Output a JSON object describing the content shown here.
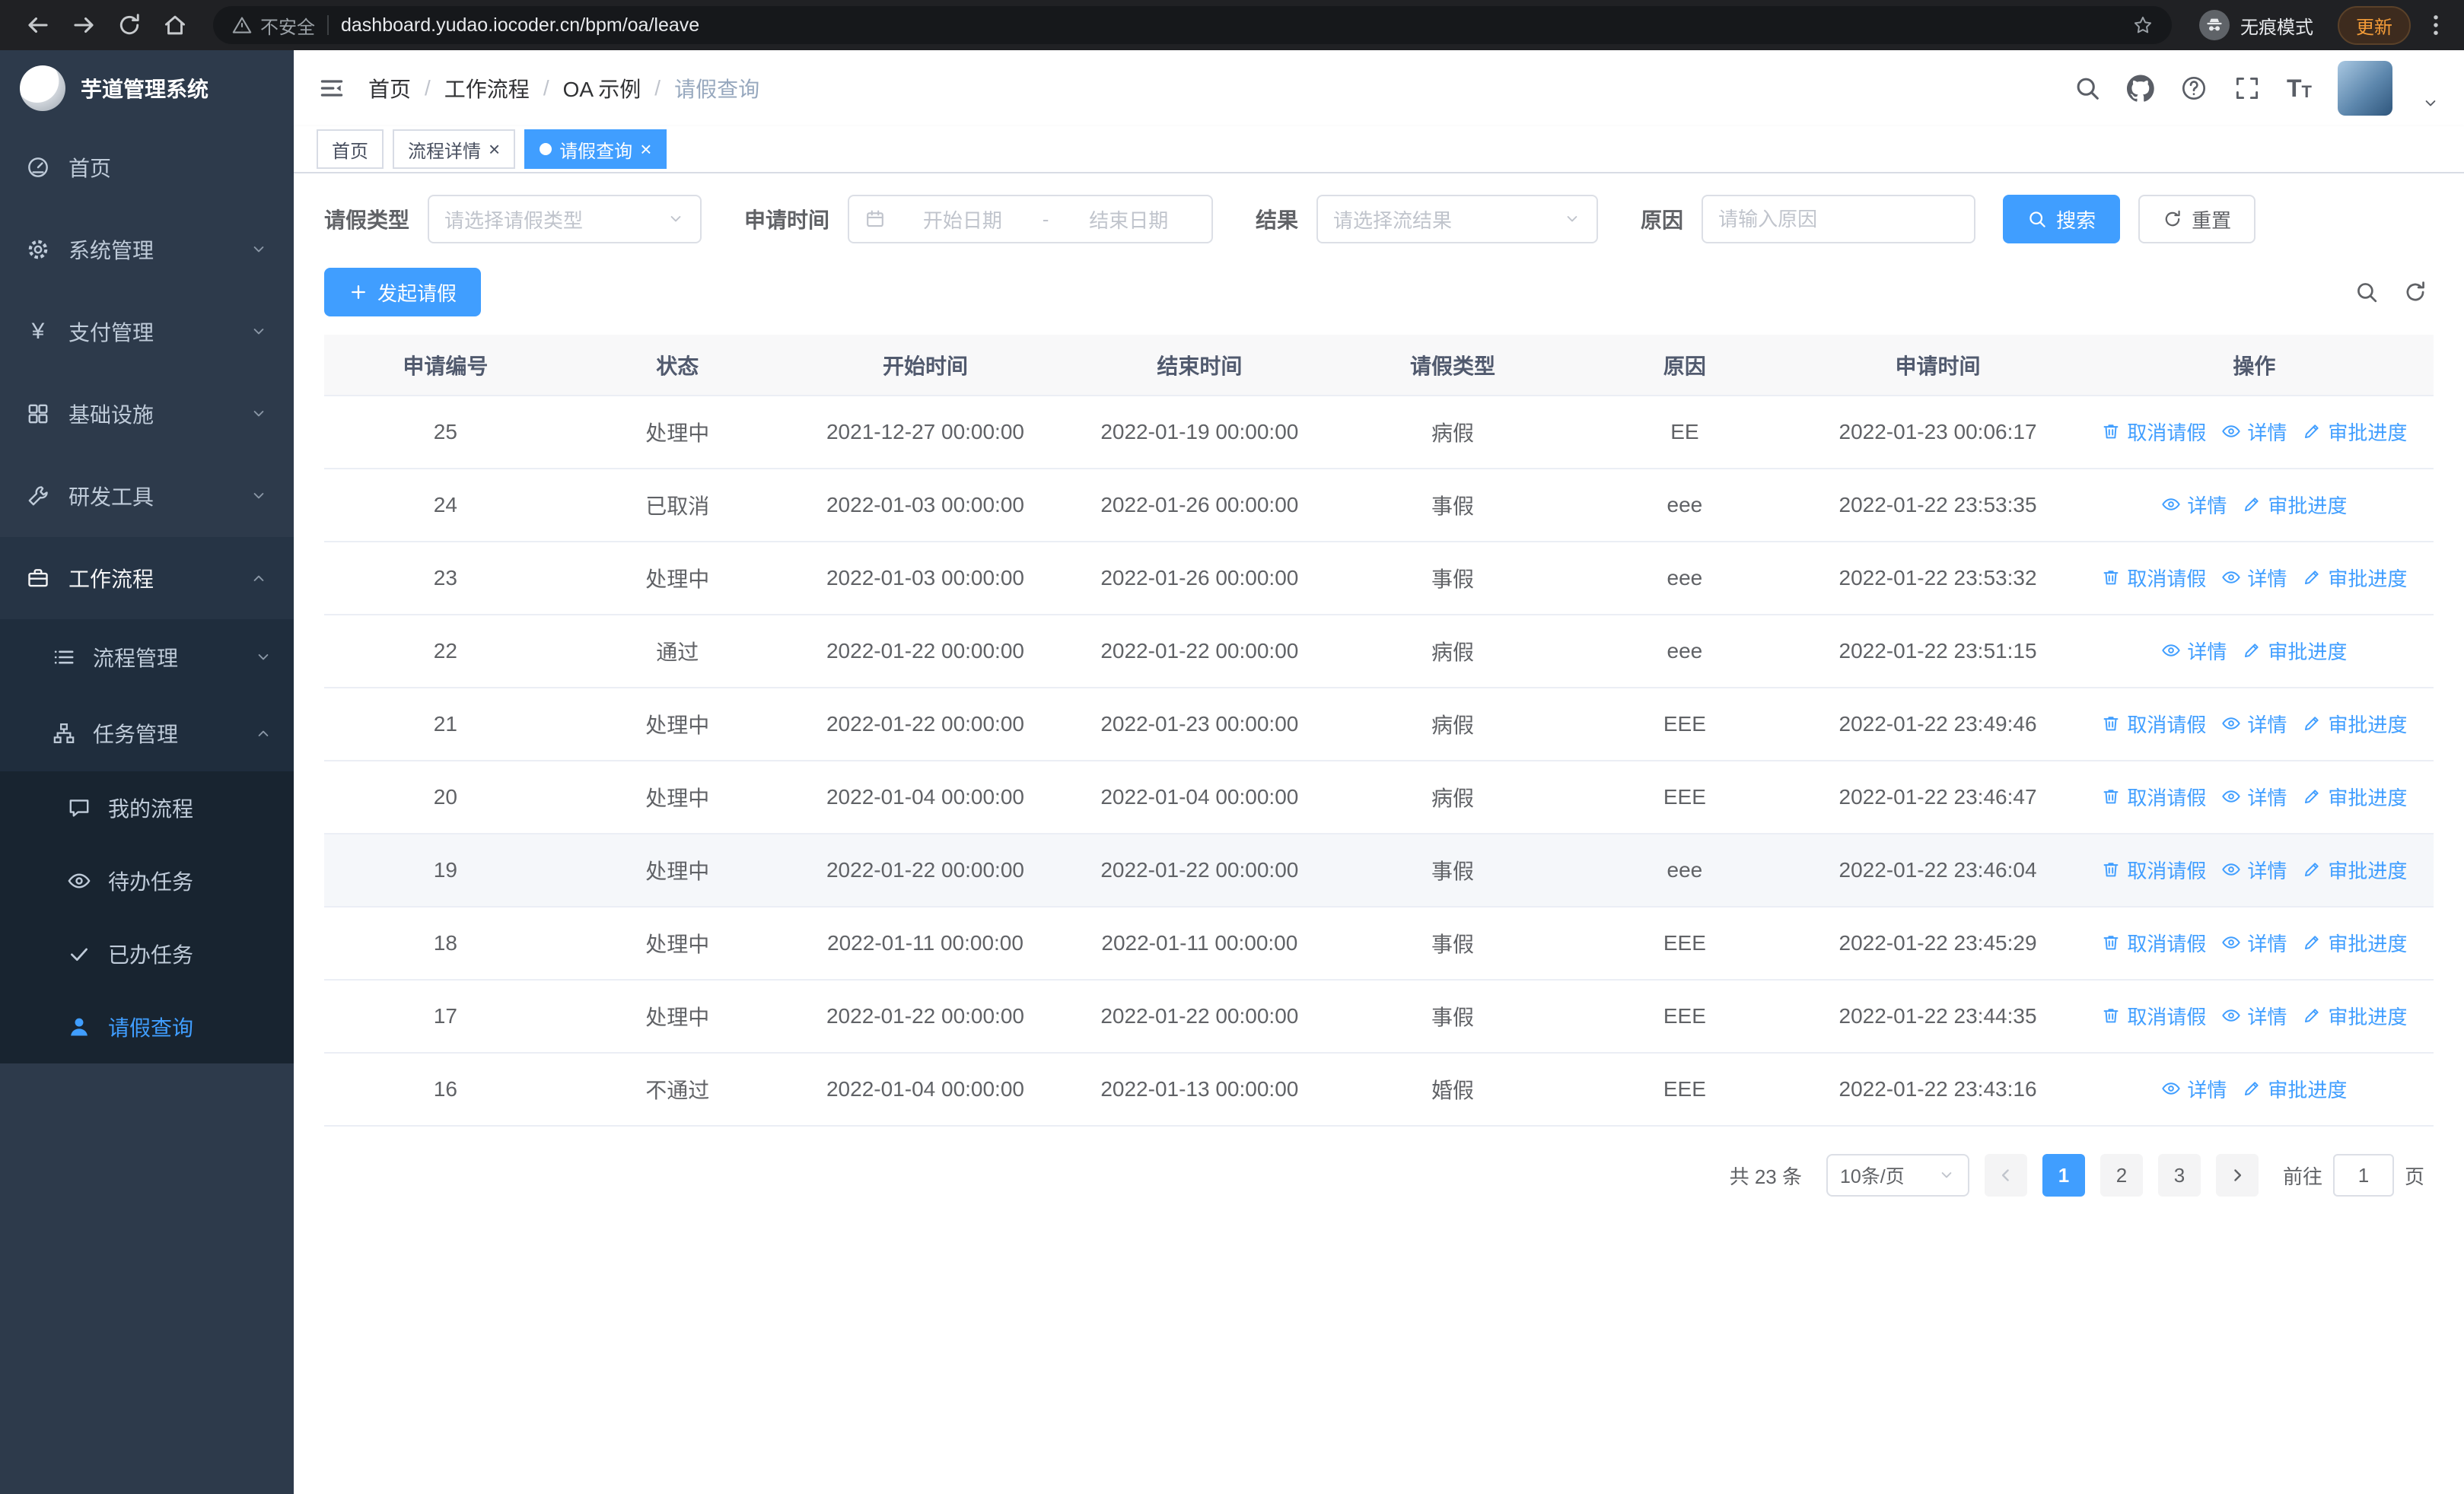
{
  "colors": {
    "primary": "#409eff",
    "sidebar_bg": "#2d3a4b",
    "update_accent": "#f29b38"
  },
  "glyphs": {
    "yen": "¥",
    "close": "×",
    "font_large": "T",
    "font_small": "T"
  },
  "browser": {
    "security_warning": "不安全",
    "url": "dashboard.yudao.iocoder.cn/bpm/oa/leave",
    "incognito_label": "无痕模式",
    "update_button": "更新"
  },
  "sidebar": {
    "logo_title": "芋道管理系统",
    "items": [
      {
        "label": "首页"
      },
      {
        "label": "系统管理"
      },
      {
        "label": "支付管理"
      },
      {
        "label": "基础设施"
      },
      {
        "label": "研发工具"
      },
      {
        "label": "工作流程"
      },
      {
        "label": "流程管理"
      },
      {
        "label": "任务管理"
      },
      {
        "label": "我的流程"
      },
      {
        "label": "待办任务"
      },
      {
        "label": "已办任务"
      },
      {
        "label": "请假查询"
      }
    ]
  },
  "header": {
    "breadcrumb": [
      "首页",
      "工作流程",
      "OA 示例",
      "请假查询"
    ],
    "separator": "/"
  },
  "tabbar": {
    "tabs": [
      {
        "label": "首页"
      },
      {
        "label": "流程详情"
      },
      {
        "label": "请假查询"
      }
    ]
  },
  "filters": {
    "leave_type_label": "请假类型",
    "leave_type_placeholder": "请选择请假类型",
    "apply_time_label": "申请时间",
    "start_date_placeholder": "开始日期",
    "range_separator": "-",
    "end_date_placeholder": "结束日期",
    "result_label": "结果",
    "result_placeholder": "请选择流结果",
    "reason_label": "原因",
    "reason_placeholder": "请输入原因",
    "search_button": "搜索",
    "reset_button": "重置"
  },
  "toolbar": {
    "create_button": "发起请假"
  },
  "table": {
    "columns": [
      "申请编号",
      "状态",
      "开始时间",
      "结束时间",
      "请假类型",
      "原因",
      "申请时间",
      "操作"
    ],
    "actions": {
      "cancel": "取消请假",
      "detail": "详情",
      "progress": "审批进度"
    },
    "rows": [
      {
        "id": "25",
        "status": "处理中",
        "start": "2021-12-27 00:00:00",
        "end": "2022-01-19 00:00:00",
        "type": "病假",
        "reason": "EE",
        "apply_time": "2022-01-23 00:06:17",
        "can_cancel": true,
        "highlight": false
      },
      {
        "id": "24",
        "status": "已取消",
        "start": "2022-01-03 00:00:00",
        "end": "2022-01-26 00:00:00",
        "type": "事假",
        "reason": "eee",
        "apply_time": "2022-01-22 23:53:35",
        "can_cancel": false,
        "highlight": false
      },
      {
        "id": "23",
        "status": "处理中",
        "start": "2022-01-03 00:00:00",
        "end": "2022-01-26 00:00:00",
        "type": "事假",
        "reason": "eee",
        "apply_time": "2022-01-22 23:53:32",
        "can_cancel": true,
        "highlight": false
      },
      {
        "id": "22",
        "status": "通过",
        "start": "2022-01-22 00:00:00",
        "end": "2022-01-22 00:00:00",
        "type": "病假",
        "reason": "eee",
        "apply_time": "2022-01-22 23:51:15",
        "can_cancel": false,
        "highlight": false
      },
      {
        "id": "21",
        "status": "处理中",
        "start": "2022-01-22 00:00:00",
        "end": "2022-01-23 00:00:00",
        "type": "病假",
        "reason": "EEE",
        "apply_time": "2022-01-22 23:49:46",
        "can_cancel": true,
        "highlight": false
      },
      {
        "id": "20",
        "status": "处理中",
        "start": "2022-01-04 00:00:00",
        "end": "2022-01-04 00:00:00",
        "type": "病假",
        "reason": "EEE",
        "apply_time": "2022-01-22 23:46:47",
        "can_cancel": true,
        "highlight": false
      },
      {
        "id": "19",
        "status": "处理中",
        "start": "2022-01-22 00:00:00",
        "end": "2022-01-22 00:00:00",
        "type": "事假",
        "reason": "eee",
        "apply_time": "2022-01-22 23:46:04",
        "can_cancel": true,
        "highlight": true
      },
      {
        "id": "18",
        "status": "处理中",
        "start": "2022-01-11 00:00:00",
        "end": "2022-01-11 00:00:00",
        "type": "事假",
        "reason": "EEE",
        "apply_time": "2022-01-22 23:45:29",
        "can_cancel": true,
        "highlight": false
      },
      {
        "id": "17",
        "status": "处理中",
        "start": "2022-01-22 00:00:00",
        "end": "2022-01-22 00:00:00",
        "type": "事假",
        "reason": "EEE",
        "apply_time": "2022-01-22 23:44:35",
        "can_cancel": true,
        "highlight": false
      },
      {
        "id": "16",
        "status": "不通过",
        "start": "2022-01-04 00:00:00",
        "end": "2022-01-13 00:00:00",
        "type": "婚假",
        "reason": "EEE",
        "apply_time": "2022-01-22 23:43:16",
        "can_cancel": false,
        "highlight": false
      }
    ]
  },
  "pagination": {
    "total_text": "共 23 条",
    "page_size": "10条/页",
    "pages": [
      "1",
      "2",
      "3"
    ],
    "active_page": "1",
    "goto_label": "前往",
    "goto_value": "1",
    "goto_unit": "页"
  }
}
